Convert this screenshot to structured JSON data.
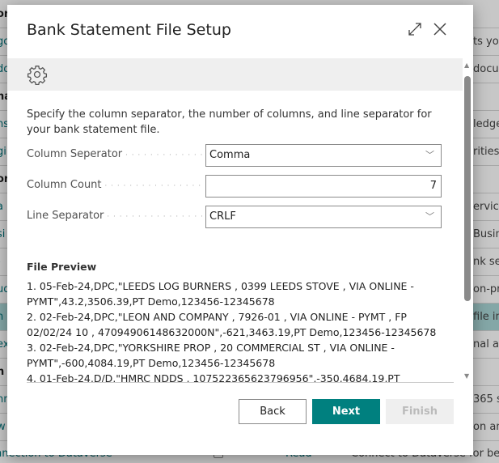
{
  "background": {
    "rows": [
      {
        "left": "or",
        "right": "",
        "bold": true
      },
      {
        "left": "go",
        "right": "ts you"
      },
      {
        "left": "do",
        "right": "docu"
      },
      {
        "left": "na",
        "right": "",
        "bold": true
      },
      {
        "left": "ns",
        "right": "ledge"
      },
      {
        "left": "gi",
        "right": "rities"
      },
      {
        "left": "or",
        "right": "",
        "bold": true
      },
      {
        "left": "a",
        "right": "ervice"
      },
      {
        "left": "si",
        "right": "Busine"
      },
      {
        "left": "-",
        "right": "nk ser"
      },
      {
        "left": "ud",
        "right": "on-pr"
      },
      {
        "left": "n",
        "right": "file in",
        "highlight": true
      },
      {
        "left": "ex",
        "right": "nal ac"
      },
      {
        "left": "h",
        "right": "",
        "bold": true
      },
      {
        "left": "nn",
        "right": "365 s"
      },
      {
        "left": "w",
        "right": "on and"
      }
    ],
    "last_row": {
      "name": "nnection to Dataverse",
      "permission": "Read",
      "description": "Connect to Dataverse for bett"
    }
  },
  "dialog": {
    "title": "Bank Statement File Setup",
    "icons": {
      "expand": "expand-icon",
      "close": "close-icon",
      "settings": "gear-icon"
    },
    "description": "Specify the column separator, the number of columns, and line separator for your bank statement file.",
    "fields": {
      "column_separator": {
        "label": "Column Seperator",
        "value": "Comma"
      },
      "column_count": {
        "label": "Column Count",
        "value": "7"
      },
      "line_separator": {
        "label": "Line Separator",
        "value": "CRLF"
      }
    },
    "file_preview": {
      "label": "File Preview",
      "lines": [
        "1.  05-Feb-24,DPC,\"LEEDS LOG BURNERS , 0399 LEEDS STOVE , VIA ONLINE - PYMT\",43.2,3506.39,PT Demo,123456-12345678",
        "2.  02-Feb-24,DPC,\"LEON AND COMPANY , 7926-01 , VIA ONLINE - PYMT , FP 02/02/24 10 , 47094906148632000N\",-621,3463.19,PT Demo,123456-12345678",
        "3.  02-Feb-24,DPC,\"YORKSHIRE PROP , 20 COMMERCIAL ST , VIA ONLINE - PYMT\",-600,4084.19,PT Demo,123456-12345678",
        "4.  01-Feb-24,D/D,\"HMRC NDDS , 107522365623796956\",-350,4684.19,PT"
      ]
    },
    "buttons": {
      "back": "Back",
      "next": "Next",
      "finish": "Finish"
    },
    "colors": {
      "primary": "#00807f",
      "disabled": "#efefef"
    }
  }
}
